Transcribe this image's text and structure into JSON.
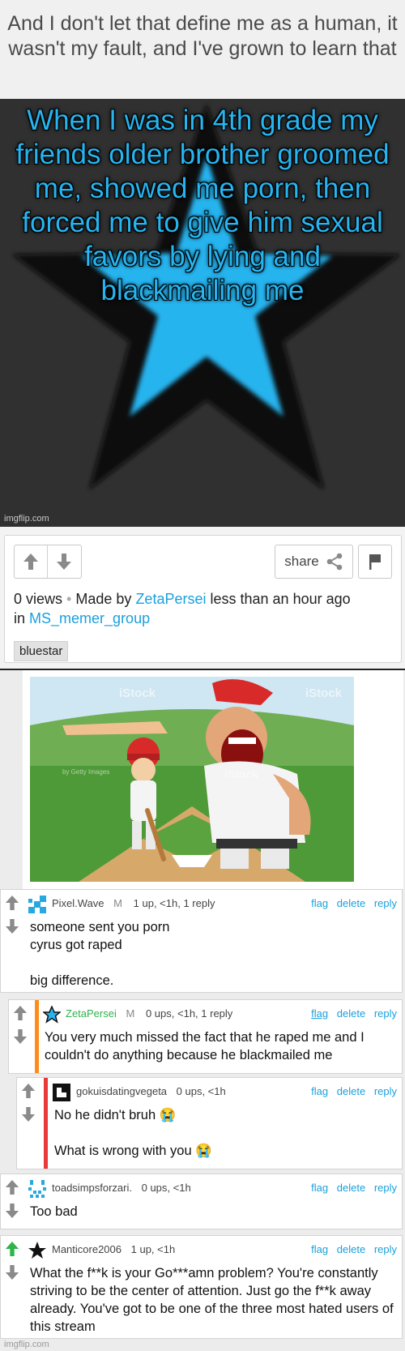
{
  "caption": "And I don't let that define me as a human, it wasn't my fault, and I've grown to learn that",
  "meme": {
    "text": "When I was in 4th grade my friends older brother groomed me, showed me porn, then forced me to give him sexual favors by lying and blackmailing me",
    "watermark": "imgflip.com",
    "text_color": "#27b4ef",
    "star_color": "#27b4ef"
  },
  "post": {
    "share_label": "share",
    "views": "0 views",
    "made_by_prefix": "Made by",
    "author": "ZetaPersei",
    "time": "less than an hour ago",
    "in_label": "in",
    "stream": "MS_memer_group",
    "tag": "bluestar",
    "icons": [
      "upvote-icon",
      "downvote-icon",
      "share-icon",
      "flag-icon"
    ]
  },
  "comment_image": {
    "watermark": "iStock",
    "credit": "by Getty Images"
  },
  "comments": [
    {
      "user": "Pixel.Wave",
      "badge": "M",
      "stats": "1 up, <1h, 1 reply",
      "actions": [
        "flag",
        "delete",
        "reply"
      ],
      "text": "someone sent you porn\ncyrus got raped\n\nbig difference."
    },
    {
      "user": "ZetaPersei",
      "badge": "M",
      "stats": "0 ups, <1h, 1 reply",
      "actions": [
        "flag",
        "delete",
        "reply"
      ],
      "text": "You very much missed the fact that he raped me and I couldn't do anything because he blackmailed me",
      "accent": "#ff8c1a"
    },
    {
      "user": "gokuisdatingvegeta",
      "stats": "0 ups, <1h",
      "actions": [
        "flag",
        "delete",
        "reply"
      ],
      "text": "No he didn't bruh 😭\n\nWhat is wrong with you 😭",
      "accent": "#e83a3a"
    },
    {
      "user": "toadsimpsforzari.",
      "stats": "0 ups, <1h",
      "actions": [
        "flag",
        "delete",
        "reply"
      ],
      "text": "Too bad"
    },
    {
      "user": "Manticore2006",
      "stats": "1 up, <1h",
      "actions": [
        "flag",
        "delete",
        "reply"
      ],
      "text": "What the f**k is your Go***amn problem? You're constantly striving to be the center of attention. Just go the f**k away already. You've got to be one of the three most hated users of this stream",
      "upvoted_color": "#2fb34a"
    }
  ],
  "footer_watermark": "imgflip.com"
}
